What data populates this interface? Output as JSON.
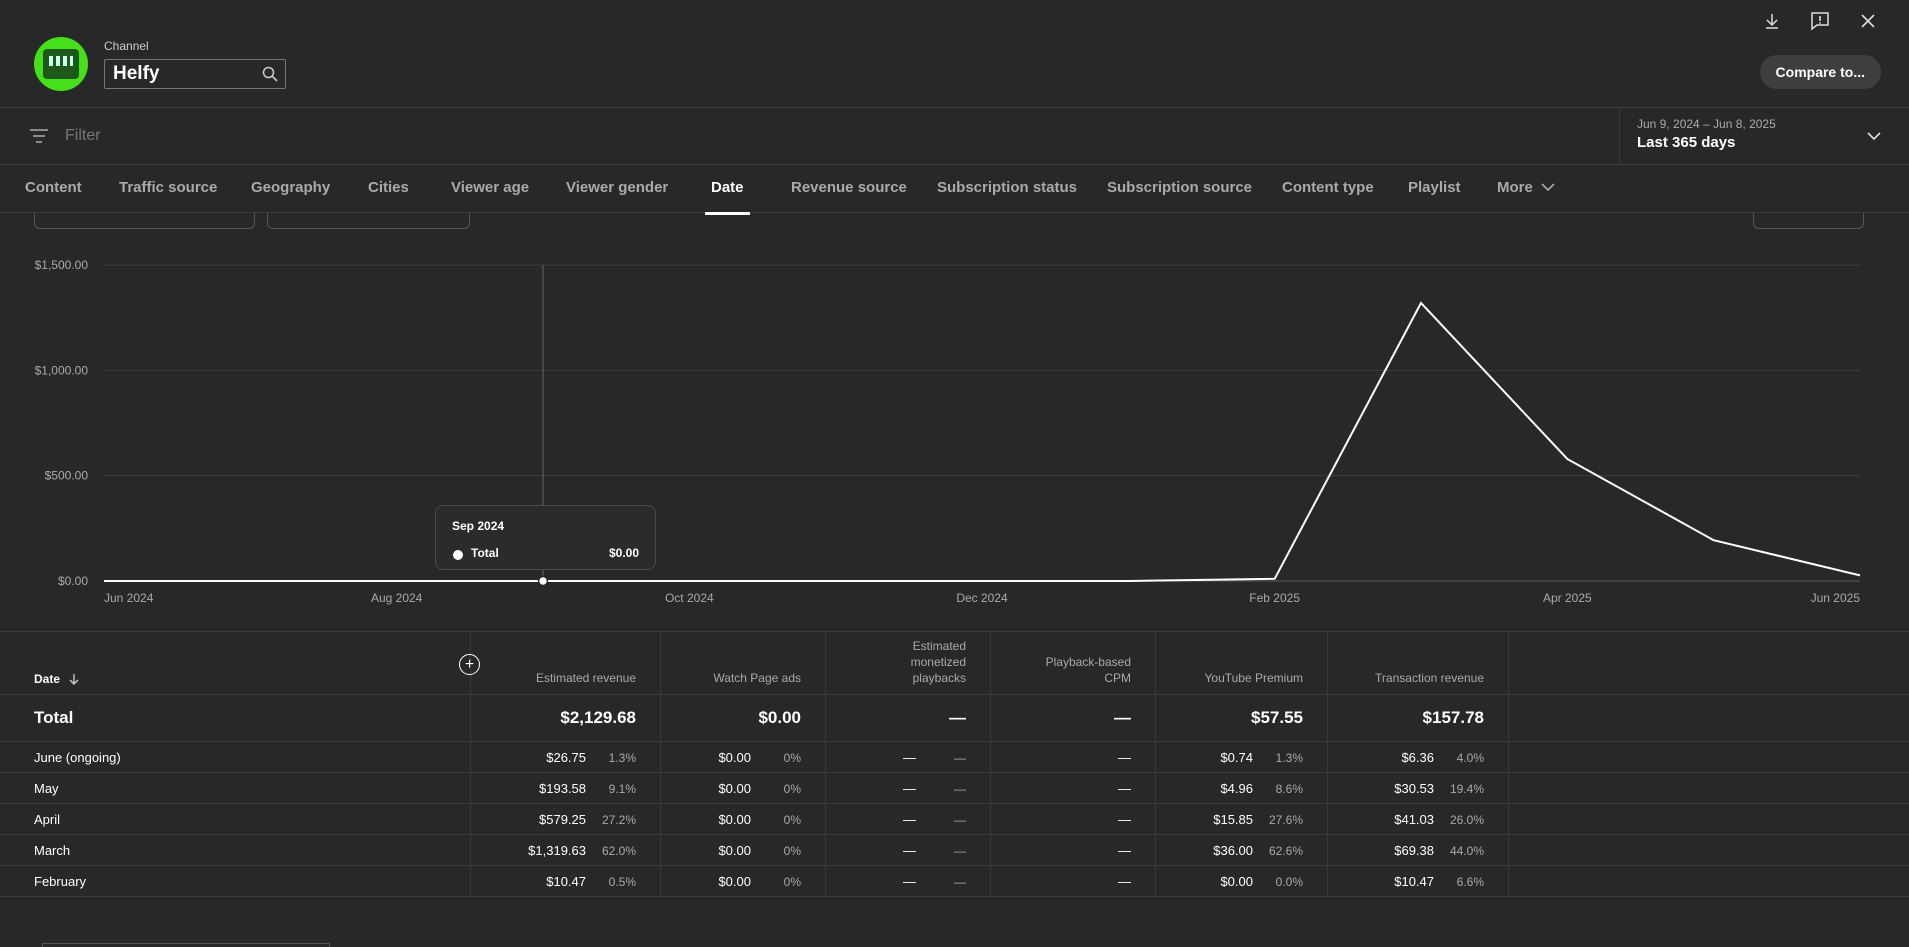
{
  "header": {
    "channel_label": "Channel",
    "channel_name": "Helfy",
    "compare_label": "Compare to..."
  },
  "filter": {
    "placeholder": "Filter"
  },
  "date_range": {
    "range": "Jun 9, 2024 – Jun 8, 2025",
    "preset": "Last 365 days"
  },
  "tabs": [
    {
      "label": "Content"
    },
    {
      "label": "Traffic source"
    },
    {
      "label": "Geography"
    },
    {
      "label": "Cities"
    },
    {
      "label": "Viewer age"
    },
    {
      "label": "Viewer gender"
    },
    {
      "label": "Date"
    },
    {
      "label": "Revenue source"
    },
    {
      "label": "Subscription status"
    },
    {
      "label": "Subscription source"
    },
    {
      "label": "Content type"
    },
    {
      "label": "Playlist"
    },
    {
      "label": "More"
    }
  ],
  "active_tab": "Date",
  "chart_data": {
    "type": "line",
    "x_tick_labels": [
      "Jun 2024",
      "Aug 2024",
      "Oct 2024",
      "Dec 2024",
      "Feb 2025",
      "Apr 2025",
      "Jun 2025"
    ],
    "y_tick_labels": [
      "$0.00",
      "$500.00",
      "$1,000.00",
      "$1,500.00"
    ],
    "ylim": [
      0,
      1500
    ],
    "x": [
      "2024-06",
      "2024-07",
      "2024-08",
      "2024-09",
      "2024-10",
      "2024-11",
      "2024-12",
      "2025-01",
      "2025-02",
      "2025-03",
      "2025-04",
      "2025-05",
      "2025-06"
    ],
    "values": [
      0,
      0,
      0,
      0,
      0,
      0,
      0,
      0,
      10.47,
      1319.63,
      579.25,
      193.58,
      26.75
    ],
    "grid": true,
    "line_color": "#ffffff",
    "hover_index": 3,
    "tooltip": {
      "title": "Sep 2024",
      "label": "Total",
      "value": "$0.00"
    }
  },
  "table": {
    "date_header": "Date",
    "columns": [
      {
        "label": "Estimated revenue"
      },
      {
        "label": "Watch Page ads"
      },
      {
        "label": "Estimated monetized playbacks"
      },
      {
        "label": "Playback-based CPM"
      },
      {
        "label": "YouTube Premium"
      },
      {
        "label": "Transaction revenue"
      }
    ],
    "total": {
      "label": "Total",
      "values": [
        "$2,129.68",
        "$0.00",
        "—",
        "—",
        "$57.55",
        "$157.78"
      ]
    },
    "rows": [
      {
        "label": "June (ongoing)",
        "values": [
          "$26.75",
          "$0.00",
          "—",
          "—",
          "$0.74",
          "$6.36"
        ],
        "pcts": [
          "1.3%",
          "0%",
          "—",
          "",
          "1.3%",
          "4.0%"
        ]
      },
      {
        "label": "May",
        "values": [
          "$193.58",
          "$0.00",
          "—",
          "—",
          "$4.96",
          "$30.53"
        ],
        "pcts": [
          "9.1%",
          "0%",
          "—",
          "",
          "8.6%",
          "19.4%"
        ]
      },
      {
        "label": "April",
        "values": [
          "$579.25",
          "$0.00",
          "—",
          "—",
          "$15.85",
          "$41.03"
        ],
        "pcts": [
          "27.2%",
          "0%",
          "—",
          "",
          "27.6%",
          "26.0%"
        ]
      },
      {
        "label": "March",
        "values": [
          "$1,319.63",
          "$0.00",
          "—",
          "—",
          "$36.00",
          "$69.38"
        ],
        "pcts": [
          "62.0%",
          "0%",
          "—",
          "",
          "62.6%",
          "44.0%"
        ]
      },
      {
        "label": "February",
        "values": [
          "$10.47",
          "$0.00",
          "—",
          "—",
          "$0.00",
          "$10.47"
        ],
        "pcts": [
          "0.5%",
          "0%",
          "—",
          "",
          "0.0%",
          "6.6%"
        ]
      }
    ]
  },
  "icons": [
    "download-icon",
    "feedback-icon",
    "close-icon",
    "search-icon",
    "filter-icon",
    "chevron-down-icon",
    "sort-down-icon",
    "add-metric-icon"
  ]
}
